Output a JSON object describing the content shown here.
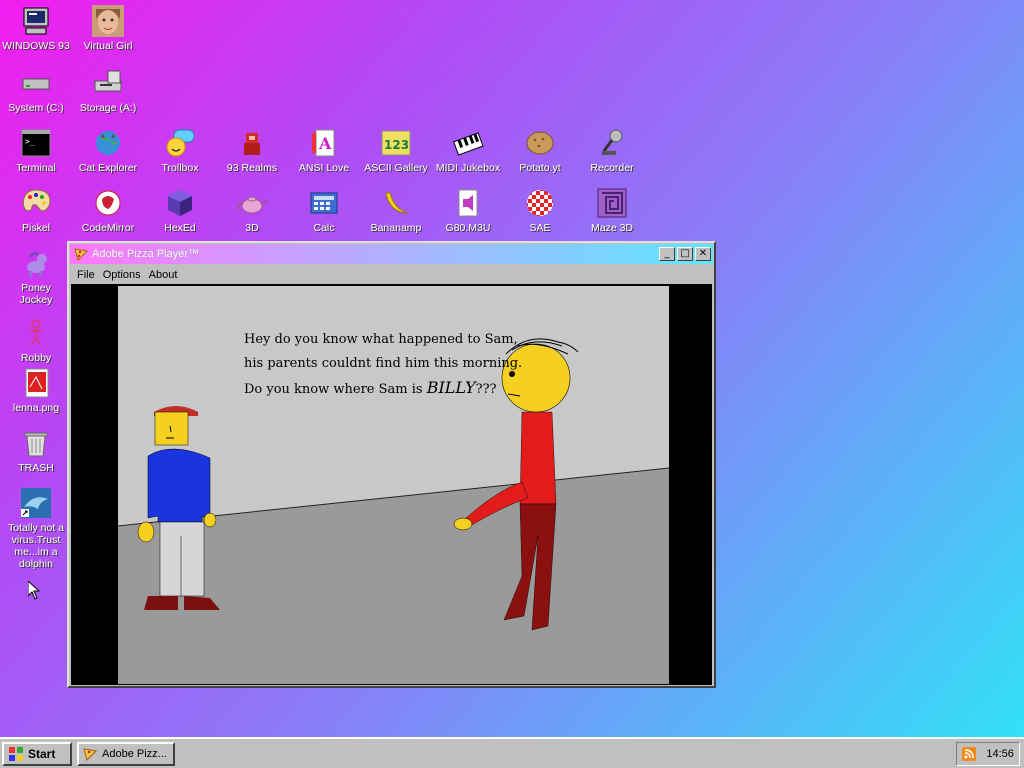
{
  "desktop": {
    "icons": [
      {
        "label": "WINDOWS 93",
        "icon": "computer-icon"
      },
      {
        "label": "Virtual Girl",
        "icon": "face-icon"
      },
      {
        "label": "System (C:)",
        "icon": "drive-icon"
      },
      {
        "label": "Storage (A:)",
        "icon": "floppy-icon"
      },
      {
        "label": "Terminal",
        "icon": "terminal-icon"
      },
      {
        "label": "Cat Explorer",
        "icon": "globe-cat-icon"
      },
      {
        "label": "Trollbox",
        "icon": "chat-icon"
      },
      {
        "label": "93 Realms",
        "icon": "realms-icon"
      },
      {
        "label": "ANSI Love",
        "icon": "ansi-icon"
      },
      {
        "label": "ASCII Gallery",
        "icon": "ascii-icon"
      },
      {
        "label": "MIDI Jukebox",
        "icon": "piano-icon"
      },
      {
        "label": "Potato.yt",
        "icon": "potato-icon"
      },
      {
        "label": "Recorder",
        "icon": "microphone-icon"
      },
      {
        "label": "Piskel",
        "icon": "palette-icon"
      },
      {
        "label": "CodeMirror",
        "icon": "codemirror-icon"
      },
      {
        "label": "HexEd",
        "icon": "cube-icon"
      },
      {
        "label": "3D",
        "icon": "teapot-icon"
      },
      {
        "label": "Calc",
        "icon": "calculator-icon"
      },
      {
        "label": "Bananamp",
        "icon": "banana-icon"
      },
      {
        "label": "G80.M3U",
        "icon": "playlist-icon"
      },
      {
        "label": "SAE",
        "icon": "checkered-ball-icon"
      },
      {
        "label": "Maze 3D",
        "icon": "maze-icon"
      },
      {
        "label": "Poney\nJockey",
        "icon": "pony-icon"
      },
      {
        "label": "Robby",
        "icon": "stickman-icon"
      },
      {
        "label": "lenna.png",
        "icon": "image-file-icon"
      },
      {
        "label": "TRASH",
        "icon": "trash-icon"
      },
      {
        "label": "Totally not a\nvirus.Trust\nme...im a\ndolphin",
        "icon": "dolphin-icon"
      }
    ]
  },
  "window": {
    "title": "Adobe Pizza Player™",
    "minimize": "_",
    "maximize": "□",
    "close": "✕",
    "menu": [
      "File",
      "Options",
      "About"
    ],
    "scene_text": {
      "line1": "Hey do you know what happened to Sam,",
      "line2": "his parents couldnt find him this morning.",
      "line3_prefix": "Do you know where Sam is ",
      "line3_emph": "BILLY",
      "line3_suffix": "???"
    }
  },
  "taskbar": {
    "start_label": "Start",
    "task_label": "Adobe Pizz...",
    "clock": "14:56"
  },
  "colors": {
    "desktop_gradient_start": "#f21df0",
    "desktop_gradient_end": "#2fe4f7",
    "title_gradient_start": "#ff77ff",
    "title_gradient_end": "#5fe6ff"
  }
}
